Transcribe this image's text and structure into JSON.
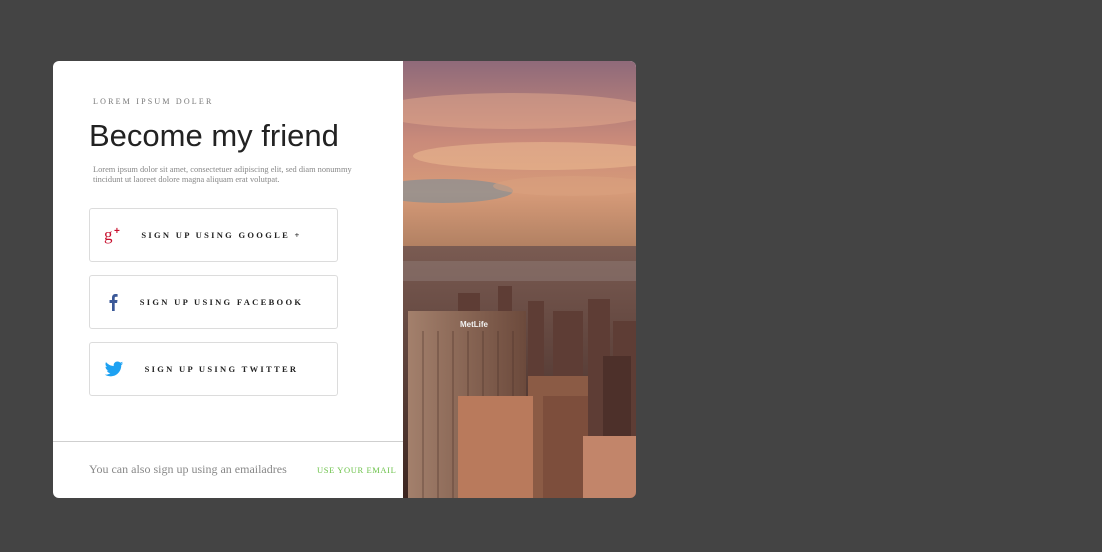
{
  "signup": {
    "eyebrow": "LOREM IPSUM DOLER",
    "title": "Become my friend",
    "description": "Lorem ipsum dolor sit amet, consectetuer adipiscing elit, sed diam nonummy tincidunt ut laoreet dolore magna aliquam erat volutpat.",
    "buttons": [
      {
        "label": "SIGN UP USING GOOGLE +",
        "icon": "google-plus-icon",
        "color": "#c8102e"
      },
      {
        "label": "SIGN UP USING FACEBOOK",
        "icon": "facebook-icon",
        "color": "#3b5998"
      },
      {
        "label": "SIGN UP USING TWITTER",
        "icon": "twitter-icon",
        "color": "#1da1f2"
      }
    ],
    "footer_text": "You can also sign up using an emailadres",
    "email_link": "USE YOUR EMAIL",
    "accent_color": "#6cc24a"
  },
  "hero_image": {
    "building_sign": "MetLife"
  }
}
